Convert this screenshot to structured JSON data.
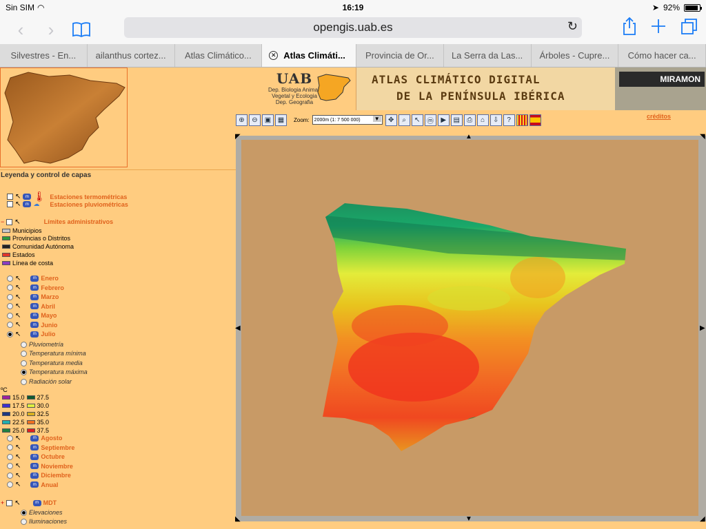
{
  "status": {
    "carrier": "Sin SIM",
    "time": "16:19",
    "battery": "92%",
    "battery_level": 0.92
  },
  "browser": {
    "url": "opengis.uab.es"
  },
  "tabs": [
    {
      "label": "Silvestres - En..."
    },
    {
      "label": "ailanthus cortez..."
    },
    {
      "label": "Atlas Climático..."
    },
    {
      "label": "Atlas Climáti..."
    },
    {
      "label": "Provincia de Or..."
    },
    {
      "label": "La Serra da Las..."
    },
    {
      "label": "Árboles - Cupre..."
    },
    {
      "label": "Cómo hacer ca..."
    }
  ],
  "header": {
    "uab": "UAB",
    "dept1": "Dep. Biologia Animal,",
    "dept2": "Vegetal y Ecologia",
    "dept3": "Dep. Geografia",
    "title1": "ATLAS CLIMÁTICO DIGITAL",
    "title2": "DE LA PENÍNSULA IBÉRICA",
    "brand": "MIRAMON"
  },
  "toolbar": {
    "zoom_label": "Zoom:",
    "zoom_value": "2000m (1: 7 500 000)",
    "credits": "créditos"
  },
  "legend": {
    "title": "Leyenda y control de capas",
    "stations": [
      "Estaciones termométricas",
      "Estaciones pluviométricas"
    ],
    "admin_title": "Límites administrativos",
    "admin_items": [
      "Municipios",
      "Provincias o Distritos",
      "Comunidad Autónoma",
      "Estados",
      "Línea de costa"
    ],
    "months_top": [
      "Enero",
      "Febrero",
      "Marzo",
      "Abril",
      "Mayo",
      "Junio",
      "Julio"
    ],
    "variables": [
      "Pluviometría",
      "Temperatura mínima",
      "Temperatura media",
      "Temperatura máxima",
      "Radiación solar"
    ],
    "unit": "ºC",
    "scale": [
      [
        "15.0",
        "27.5"
      ],
      [
        "17.5",
        "30.0"
      ],
      [
        "20.0",
        "32.5"
      ],
      [
        "22.5",
        "35.0"
      ],
      [
        "25.0",
        "37.5"
      ]
    ],
    "months_bottom": [
      "Agosto",
      "Septiembre",
      "Octubre",
      "Noviembre",
      "Diciembre",
      "Anual"
    ],
    "mdt": "MDT",
    "mdt_items": [
      "Elevaciones",
      "Iluminaciones"
    ]
  },
  "colors": {
    "scale_left": [
      "#a020a0",
      "#4030d0",
      "#203880",
      "#20b0b0",
      "#208040"
    ],
    "scale_right": [
      "#105a30",
      "#e0f040",
      "#d8b020",
      "#f07020",
      "#e02020"
    ]
  }
}
